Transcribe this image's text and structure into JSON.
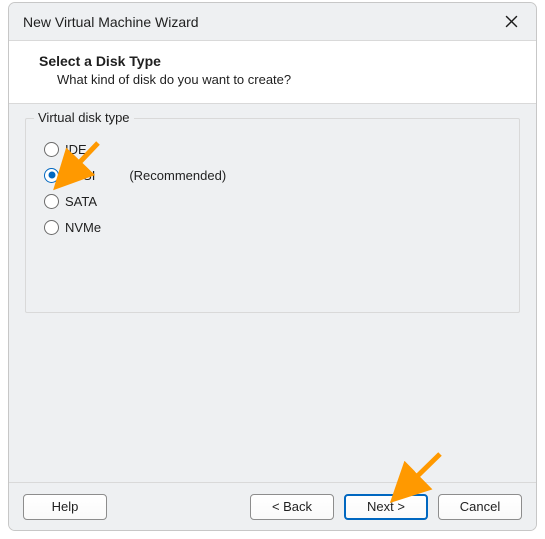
{
  "annotation_color": "#ff9900",
  "window": {
    "title": "New Virtual Machine Wizard"
  },
  "header": {
    "heading": "Select a Disk Type",
    "subheading": "What kind of disk do you want to create?"
  },
  "fieldset": {
    "legend": "Virtual disk type",
    "options": [
      {
        "label": "IDE",
        "selected": false,
        "recommended": false
      },
      {
        "label": "SCSI",
        "selected": true,
        "recommended": true
      },
      {
        "label": "SATA",
        "selected": false,
        "recommended": false
      },
      {
        "label": "NVMe",
        "selected": false,
        "recommended": false
      }
    ],
    "recommended_label": "(Recommended)"
  },
  "buttons": {
    "help": "Help",
    "back": "< Back",
    "next": "Next >",
    "cancel": "Cancel",
    "default": "next"
  }
}
